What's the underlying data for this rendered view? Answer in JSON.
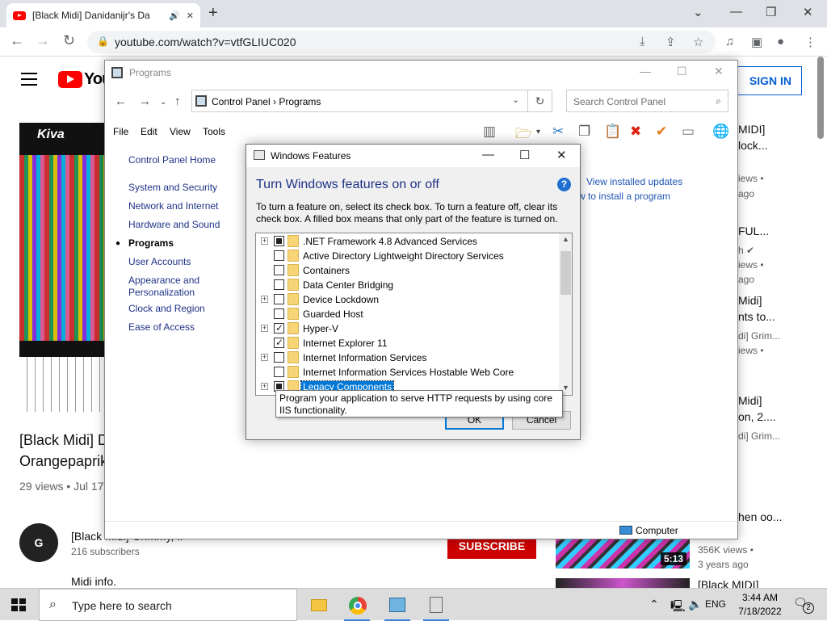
{
  "browser": {
    "tab_title": "[Black Midi] Danidanijr's Da",
    "new_tab": "+",
    "url": "youtube.com/watch?v=vtfGLIUC020"
  },
  "youtube": {
    "logo_text": "You",
    "sign_in": "SIGN IN",
    "video_overlay": "Kiva",
    "title_line1": "[Black Midi] D",
    "title_line2": "Orangepaprik",
    "meta": "29 views • Jul 17",
    "channel_avatar": "G",
    "channel_name": "[Black Midi] Grimmy, Ir",
    "subscribers": "216 subscribers",
    "subscribe": "SUBSCRIBE",
    "description": "Midi info.",
    "sidebar": [
      {
        "text": "MIDI]",
        "kind": "title"
      },
      {
        "text": "lock...",
        "kind": "title"
      },
      {
        "text": "iews •",
        "kind": "meta"
      },
      {
        "text": "ago",
        "kind": "meta"
      },
      {
        "text": "FUL...",
        "kind": "title"
      },
      {
        "text": "h ✔",
        "kind": "meta"
      },
      {
        "text": "iews •",
        "kind": "meta"
      },
      {
        "text": "ago",
        "kind": "meta"
      },
      {
        "text": "Midi]",
        "kind": "title"
      },
      {
        "text": "nts to...",
        "kind": "title"
      },
      {
        "text": "di] Grim...",
        "kind": "meta"
      },
      {
        "text": "iews •",
        "kind": "meta"
      },
      {
        "text": "Midi]",
        "kind": "title"
      },
      {
        "text": "on, 2....",
        "kind": "title"
      },
      {
        "text": "di] Grim...",
        "kind": "meta"
      },
      {
        "text": "hen oo...",
        "kind": "title"
      },
      {
        "text": "356K views •",
        "kind": "meta"
      },
      {
        "text": "3 years ago",
        "kind": "meta"
      },
      {
        "text": "[Black MIDI]",
        "kind": "title"
      }
    ],
    "thumb_duration": "5:13"
  },
  "control_panel": {
    "title": "Programs",
    "breadcrumb": "Control Panel  ›  Programs",
    "search_placeholder": "Search Control Panel",
    "menu": [
      "File",
      "Edit",
      "View",
      "Tools"
    ],
    "left_links": [
      "Control Panel Home",
      "System and Security",
      "Network and Internet",
      "Hardware and Sound",
      "Programs",
      "User Accounts",
      "Appearance and Personalization",
      "Clock and Region",
      "Ease of Access"
    ],
    "right_links": [
      "View installed updates",
      "w to install a program"
    ],
    "status": "Computer"
  },
  "windows_features": {
    "title": "Windows Features",
    "heading": "Turn Windows features on or off",
    "help": "?",
    "description": "To turn a feature on, select its check box. To turn a feature off, clear its check box. A filled box means that only part of the feature is turned on.",
    "items": [
      {
        "label": ".NET Framework 4.8 Advanced Services",
        "state": "partial",
        "expandable": true
      },
      {
        "label": "Active Directory Lightweight Directory Services",
        "state": "unchecked",
        "expandable": false
      },
      {
        "label": "Containers",
        "state": "unchecked",
        "expandable": false
      },
      {
        "label": "Data Center Bridging",
        "state": "unchecked",
        "expandable": false
      },
      {
        "label": "Device Lockdown",
        "state": "unchecked",
        "expandable": true
      },
      {
        "label": "Guarded Host",
        "state": "unchecked",
        "expandable": false
      },
      {
        "label": "Hyper-V",
        "state": "checked",
        "expandable": true
      },
      {
        "label": "Internet Explorer 11",
        "state": "checked",
        "expandable": false
      },
      {
        "label": "Internet Information Services",
        "state": "unchecked",
        "expandable": true
      },
      {
        "label": "Internet Information Services Hostable Web Core",
        "state": "unchecked",
        "expandable": false
      },
      {
        "label": "Legacy Components",
        "state": "partial",
        "expandable": true,
        "selected": true
      }
    ],
    "ok": "OK",
    "cancel": "Cancel",
    "tooltip": "Program your application to serve HTTP requests by using core IIS functionality."
  },
  "taskbar": {
    "search_placeholder": "Type here to search",
    "language": "ENG",
    "time": "3:44 AM",
    "date": "7/18/2022",
    "notification_count": "2"
  }
}
